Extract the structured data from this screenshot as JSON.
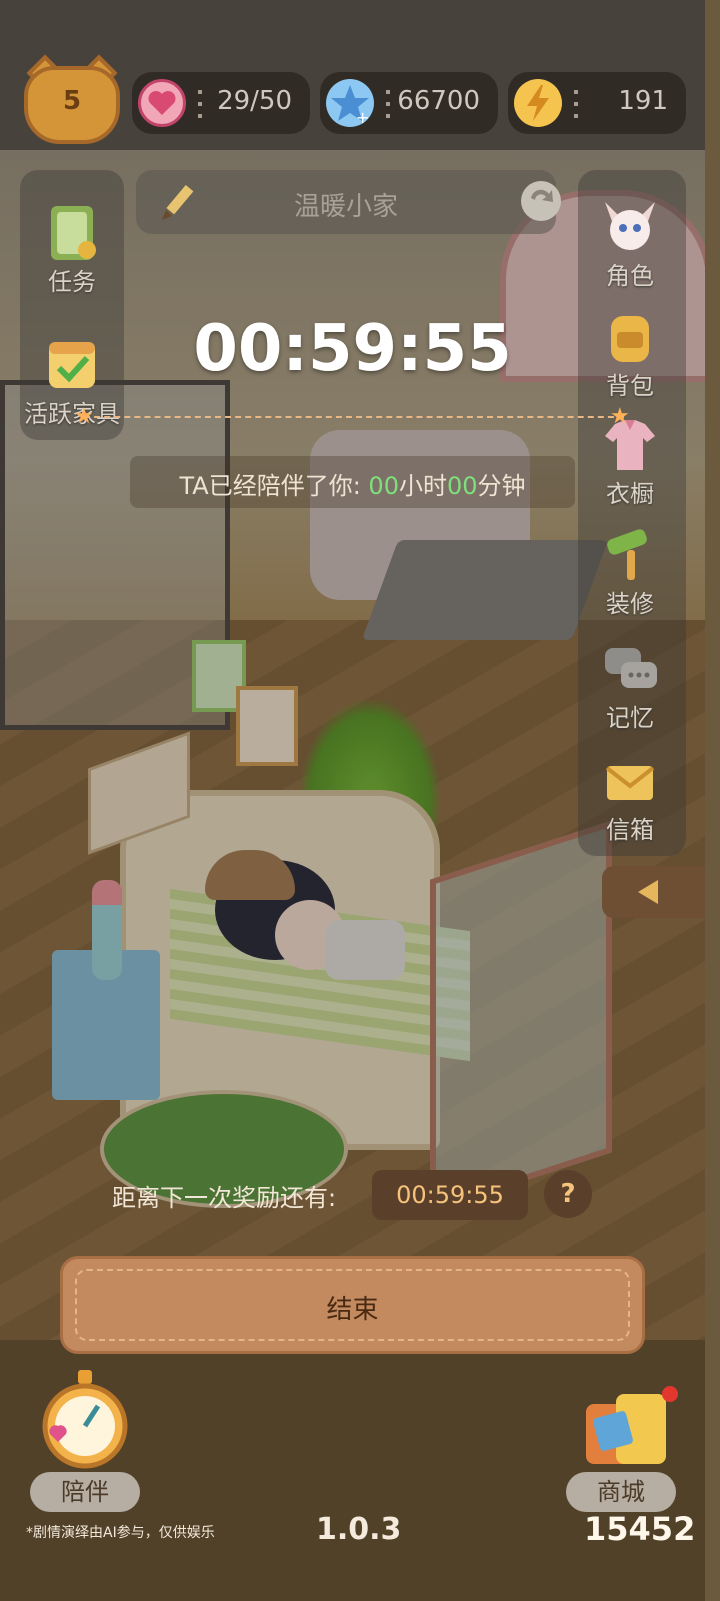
{
  "status_bar": {
    "level": "5",
    "hearts": "29/50",
    "stars": "66700",
    "energy": "191"
  },
  "room": {
    "name": "温暖小家"
  },
  "left_menu": {
    "tasks": "任务",
    "active_furniture": "活跃家具"
  },
  "right_menu": {
    "character": "角色",
    "backpack": "背包",
    "wardrobe": "衣橱",
    "decorate": "装修",
    "memory": "记忆",
    "mailbox": "信箱"
  },
  "timer": {
    "countdown": "00:59:55",
    "accompany_prefix": "TA已经陪伴了你: ",
    "hours": "00",
    "hours_unit": "小时",
    "minutes": "00",
    "minutes_unit": "分钟"
  },
  "reward": {
    "label": "距离下一次奖励还有:",
    "countdown": "00:59:55",
    "help": "?"
  },
  "end_button": "结束",
  "bottom": {
    "accompany": "陪伴",
    "shop": "商城",
    "disclaimer": "*剧情演绎由AI参与，仅供娱乐",
    "version": "1.0.3",
    "coins": "15452"
  },
  "colors": {
    "accent_orange": "#c28a5e",
    "highlight_green": "#7ee07a",
    "reward_text": "#f6c37d"
  }
}
